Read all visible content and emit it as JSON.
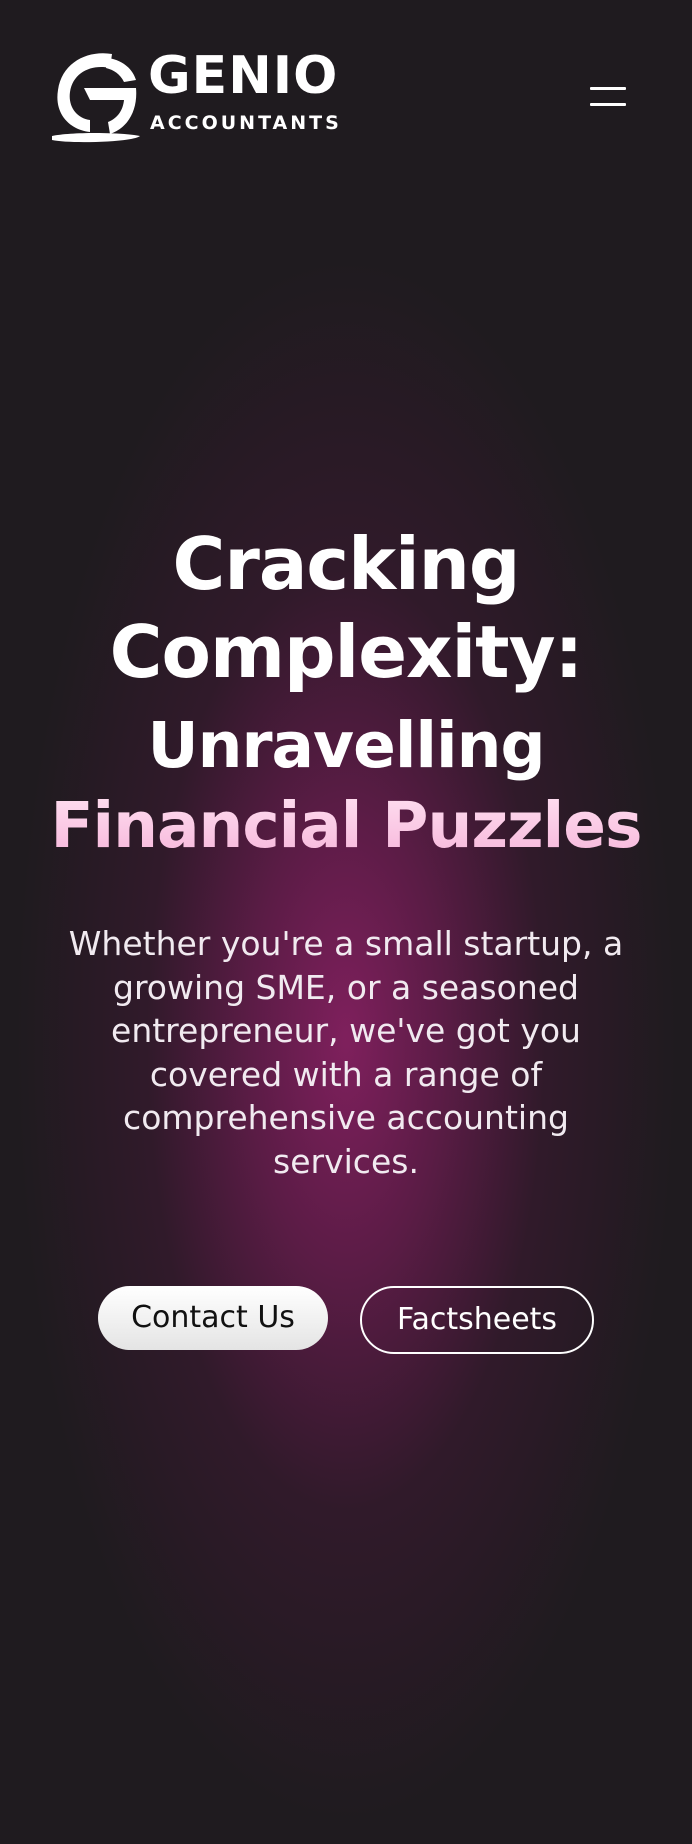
{
  "header": {
    "logo": {
      "wordmark": "GENIO",
      "subtitle": "ACCOUNTANTS"
    },
    "menu_icon": "hamburger-menu-icon"
  },
  "hero": {
    "title_line1": "Cracking",
    "title_line2": "Complexity:",
    "subtitle_line1": "Unravelling",
    "subtitle_line2": "Financial Puzzles",
    "description": "Whether you're a small startup, a growing SME, or a seasoned entrepreneur, we've got you covered with a range of comprehensive accounting services.",
    "primary_button": "Contact Us",
    "secondary_button": "Factsheets"
  },
  "colors": {
    "background": "#1f1b1f",
    "glow": "#842060",
    "accent_text": "#f9c6e3"
  }
}
